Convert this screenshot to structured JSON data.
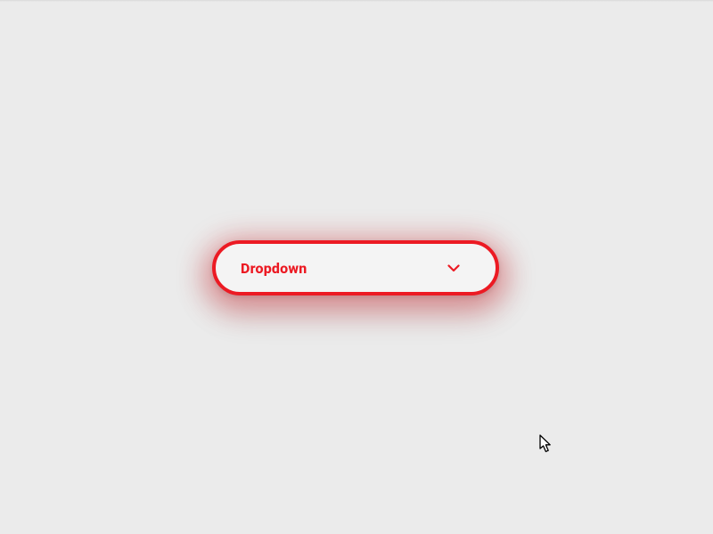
{
  "dropdown": {
    "label": "Dropdown",
    "accent_color": "#ec1a23"
  }
}
